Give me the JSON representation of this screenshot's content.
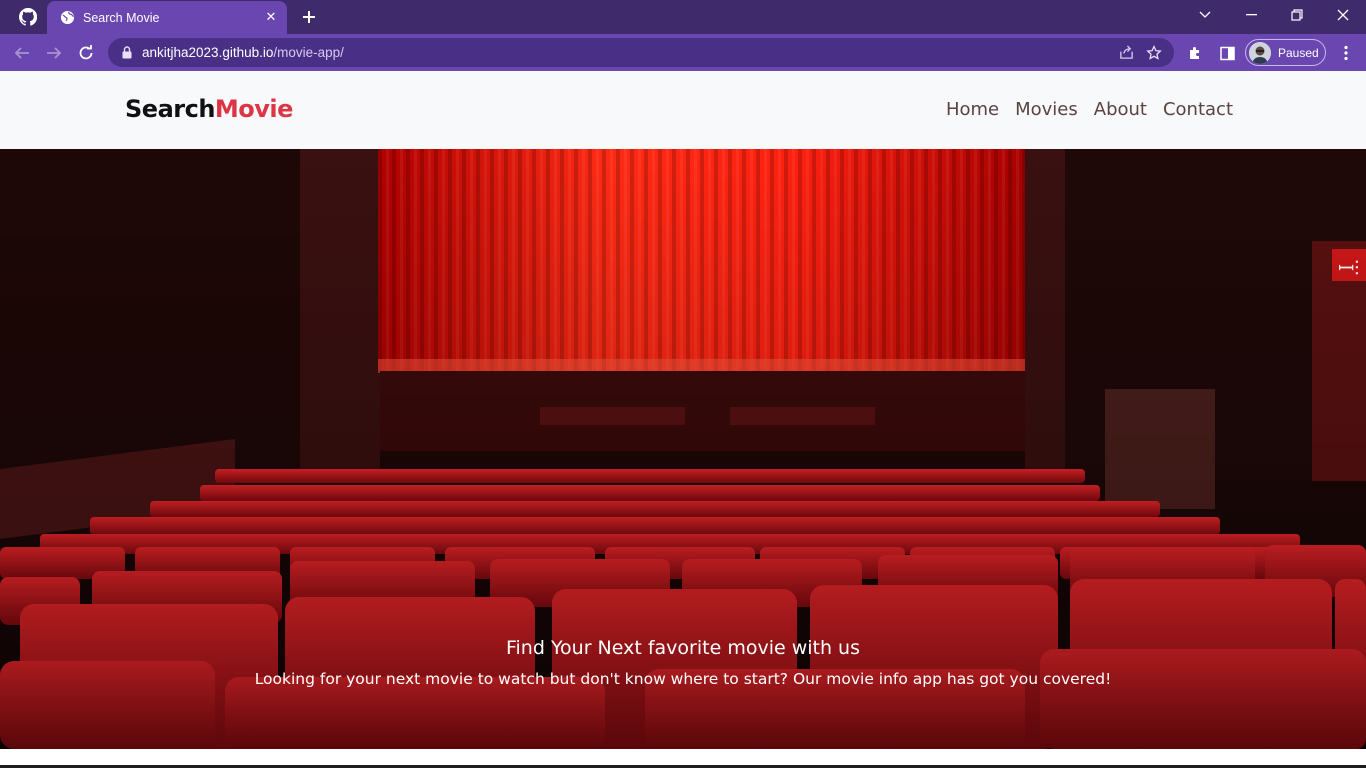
{
  "browser": {
    "tab": {
      "title": "Search Movie",
      "favicon": "globe-icon"
    },
    "url_host": "ankitjha2023.github.io",
    "url_path": "/movie-app/",
    "profile_state": "Paused",
    "colors": {
      "tabbar": "#3f2a6b",
      "toolbar": "#6a47b0",
      "omnibox": "#4a2f86"
    }
  },
  "site": {
    "logo": {
      "part1": "Search",
      "part2": "Movie"
    },
    "nav": [
      {
        "label": "Home"
      },
      {
        "label": "Movies"
      },
      {
        "label": "About"
      },
      {
        "label": "Contact"
      }
    ],
    "hero": {
      "title": "Find Your Next favorite movie with us",
      "subtitle": "Looking for your next movie to watch but don't know where to start? Our movie info app has got you covered!",
      "image": "cinema-hall-red-seats"
    },
    "colors": {
      "accent": "#dc3545",
      "header_bg": "#f8f9fa",
      "nav_text": "#5a4340"
    }
  }
}
